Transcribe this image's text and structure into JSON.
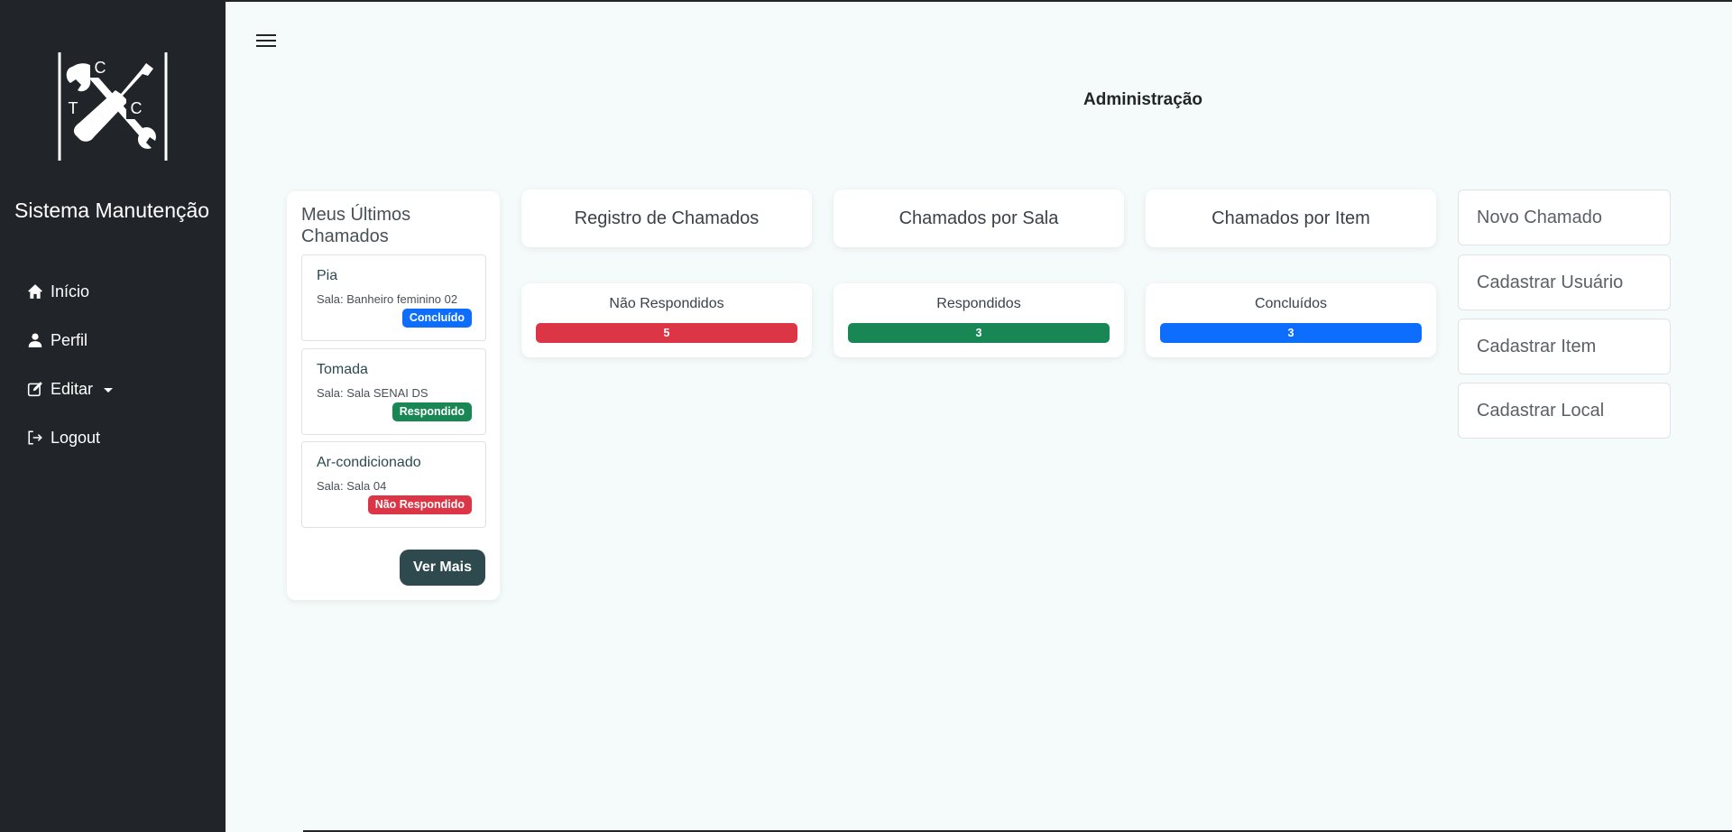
{
  "sidebar": {
    "logo_letters": [
      "C",
      "T",
      "C"
    ],
    "brand": "Sistema Manutenção",
    "items": [
      {
        "label": "Início",
        "icon": "home-icon"
      },
      {
        "label": "Perfil",
        "icon": "user-icon"
      },
      {
        "label": "Editar",
        "icon": "edit-icon"
      },
      {
        "label": "Logout",
        "icon": "logout-icon"
      }
    ]
  },
  "header": {
    "title": "Administração"
  },
  "recent": {
    "title": "Meus Últimos Chamados",
    "tickets": [
      {
        "name": "Pia",
        "room": "Sala: Banheiro feminino 02",
        "status": "Concluído",
        "status_color": "#0d6efd"
      },
      {
        "name": "Tomada",
        "room": "Sala: Sala SENAI DS",
        "status": "Respondido",
        "status_color": "#198754"
      },
      {
        "name": "Ar-condicionado",
        "room": "Sala: Sala 04",
        "status": "Não Respondido",
        "status_color": "#dc3545"
      }
    ],
    "more_label": "Ver Mais"
  },
  "reports": [
    {
      "label": "Registro de Chamados"
    },
    {
      "label": "Chamados por Sala"
    },
    {
      "label": "Chamados por Item"
    }
  ],
  "stats": [
    {
      "label": "Não Respondidos",
      "value": "5",
      "color": "#dc3545",
      "fill_pct": 100
    },
    {
      "label": "Respondidos",
      "value": "3",
      "color": "#198754",
      "fill_pct": 100
    },
    {
      "label": "Concluídos",
      "value": "3",
      "color": "#0d6efd",
      "fill_pct": 100
    }
  ],
  "actions": [
    {
      "label": "Novo Chamado"
    },
    {
      "label": "Cadastrar Usuário"
    },
    {
      "label": "Cadastrar Item"
    },
    {
      "label": "Cadastrar Local"
    }
  ]
}
